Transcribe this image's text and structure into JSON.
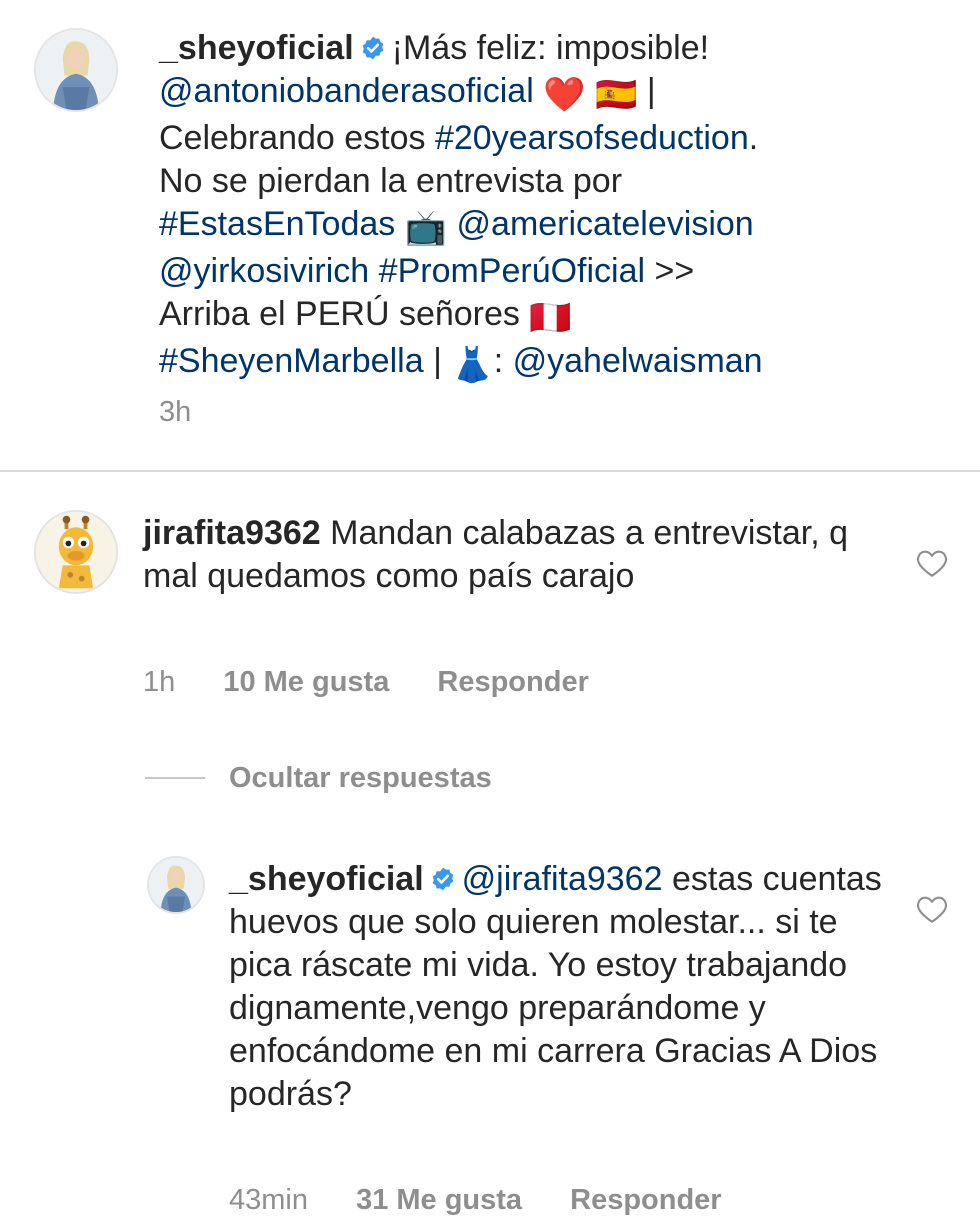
{
  "post": {
    "username": "_sheyoficial",
    "caption_part1": "¡Más feliz: imposible!",
    "mention_banderas": "@antoniobanderasoficial",
    "emoji_heart": "❤️",
    "emoji_spain": "🇪🇸",
    "pipe": "|",
    "text_celebrando": "Celebrando estos",
    "hashtag_20years": "#20yearsofseduction",
    "period": ".",
    "text_no_se": "No se pierdan la entrevista por",
    "hashtag_estas": "#EstasEnTodas",
    "emoji_tv": "📺",
    "mention_america": "@americatelevision",
    "mention_yirko": "@yirkosivirich",
    "hashtag_promperu": "#PromPerúOficial",
    "arrows": ">>",
    "text_arriba": "Arriba el PERÚ señores",
    "emoji_peru": "🇵🇪",
    "hashtag_marbella": "#SheyenMarbella",
    "pipe2": "|",
    "emoji_dress": "👗",
    "colon": ":",
    "mention_yahel": "@yahelwaisman",
    "time": "3h"
  },
  "comment1": {
    "username": "jirafita9362",
    "text": "Mandan calabazas a entrevistar, q mal quedamos como país carajo",
    "time": "1h",
    "likes": "10 Me gusta",
    "reply": "Responder"
  },
  "hide_replies": "Ocultar respuestas",
  "reply1": {
    "username": "_sheyoficial",
    "mention": "@jirafita9362",
    "text": "estas cuentas huevos que solo quieren molestar... si te pica ráscate mi vida. Yo estoy trabajando dignamente,vengo preparándome y enfocándome en mi carrera Gracias A Dios podrás?",
    "time": "43min",
    "likes": "31 Me gusta",
    "reply": "Responder"
  },
  "colors": {
    "link": "#003569",
    "verified": "#3897f0",
    "muted": "#8e8e8e",
    "divider": "#dbdbdb"
  }
}
